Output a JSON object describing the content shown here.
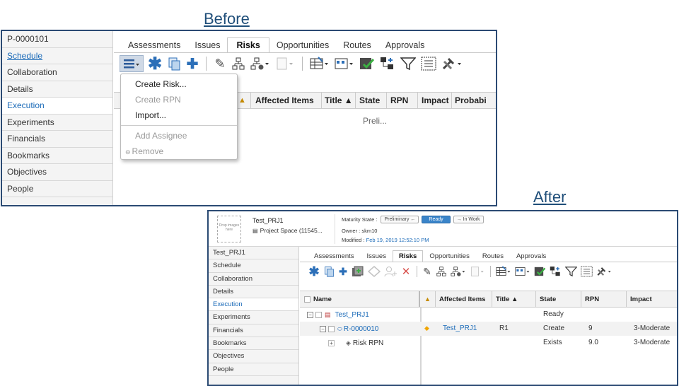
{
  "labels": {
    "before": "Before",
    "after": "After"
  },
  "before": {
    "sidebar": [
      {
        "label": "P-0000101",
        "style": "plain"
      },
      {
        "label": "Schedule",
        "style": "link"
      },
      {
        "label": "Collaboration",
        "style": "plain"
      },
      {
        "label": "Details",
        "style": "plain"
      },
      {
        "label": "Execution",
        "style": "active"
      },
      {
        "label": "Experiments",
        "style": "plain"
      },
      {
        "label": "Financials",
        "style": "plain"
      },
      {
        "label": "Bookmarks",
        "style": "plain"
      },
      {
        "label": "Objectives",
        "style": "plain"
      },
      {
        "label": "People",
        "style": "plain"
      }
    ],
    "tabs": [
      "Assessments",
      "Issues",
      "Risks",
      "Opportunities",
      "Routes",
      "Approvals"
    ],
    "active_tab": "Risks",
    "columns": [
      "Affected Items",
      "Title ▲",
      "State",
      "RPN",
      "Impact",
      "Probabi"
    ],
    "state_value": "Preli...",
    "menu": {
      "items": [
        {
          "label": "Create Risk...",
          "disabled": false
        },
        {
          "label": "Create RPN",
          "disabled": true
        },
        {
          "label": "Import...",
          "disabled": false
        },
        {
          "label": "Add Assignee",
          "disabled": true
        },
        {
          "label": "Remove",
          "disabled": true
        }
      ]
    }
  },
  "after": {
    "drop_images_text": "Drop images here",
    "object_name": "Test_PRJ1",
    "object_type": "Project Space (11545...",
    "maturity_label": "Maturity State :",
    "maturity_prev": "Preliminary ←",
    "maturity_current": "Ready",
    "maturity_next": "→ In Work",
    "owner": "Owner : skm10",
    "modified_label": "Modified :",
    "modified_value": "Feb 19, 2019 12:52:10 PM",
    "sidebar": [
      {
        "label": "Test_PRJ1",
        "style": "plain"
      },
      {
        "label": "Schedule",
        "style": "plain"
      },
      {
        "label": "Collaboration",
        "style": "plain"
      },
      {
        "label": "Details",
        "style": "plain"
      },
      {
        "label": "Execution",
        "style": "active"
      },
      {
        "label": "Experiments",
        "style": "plain"
      },
      {
        "label": "Financials",
        "style": "plain"
      },
      {
        "label": "Bookmarks",
        "style": "plain"
      },
      {
        "label": "Objectives",
        "style": "plain"
      },
      {
        "label": "People",
        "style": "plain"
      }
    ],
    "tabs": [
      "Assessments",
      "Issues",
      "Risks",
      "Opportunities",
      "Routes",
      "Approvals"
    ],
    "active_tab": "Risks",
    "columns": {
      "name": "Name",
      "affected": "Affected Items",
      "title": "Title ▲",
      "state": "State",
      "rpn": "RPN",
      "impact": "Impact"
    },
    "rows": [
      {
        "name": "Test_PRJ1",
        "affected": "",
        "title": "",
        "state": "Ready",
        "rpn": "",
        "impact": ""
      },
      {
        "name": "R-0000010",
        "affected": "Test_PRJ1",
        "title": "R1",
        "state": "Create",
        "rpn": "9",
        "impact": "3-Moderate"
      },
      {
        "name": "Risk RPN",
        "affected": "",
        "title": "",
        "state": "Exists",
        "rpn": "9.0",
        "impact": "3-Moderate"
      }
    ]
  },
  "colors": {
    "frame": "#2b4a73",
    "link": "#1a6ab8",
    "heading": "#1f4e79",
    "ready": "#3a84c9"
  }
}
